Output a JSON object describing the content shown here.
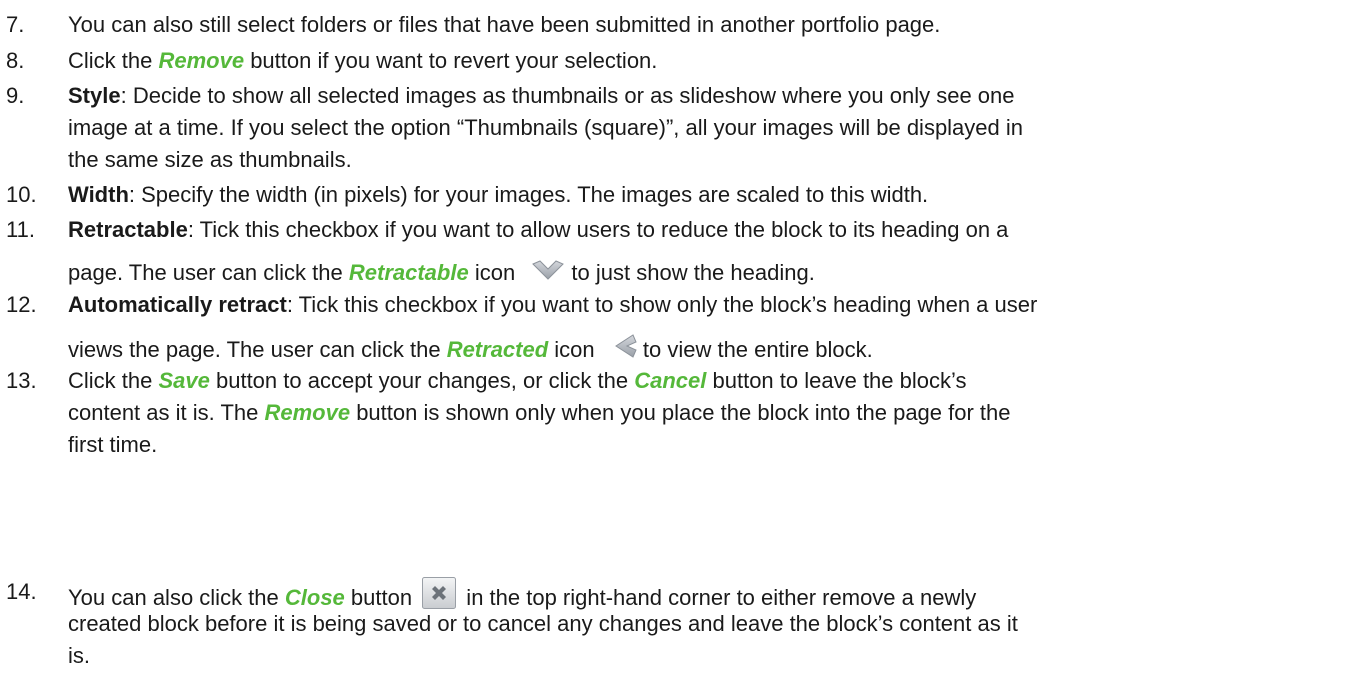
{
  "colors": {
    "term": "#55b83a",
    "text": "#1a1a1a"
  },
  "icons": {
    "retractable": "chevron-down-icon",
    "retracted": "chevron-left-icon",
    "close": "close-icon"
  },
  "items": {
    "i7": {
      "num": "7.",
      "text": "You can also still select folders or files that have been submitted in another portfolio page."
    },
    "i8": {
      "num": "8.",
      "pre": "Click the ",
      "term": "Remove",
      "post": " button if you want to revert your selection."
    },
    "i9": {
      "num": "9.",
      "label": "Style",
      "l1": ": Decide to show all selected images as thumbnails or as slideshow where you only see one",
      "l2": "image at a time. If you select the option “Thumbnails (square)”, all your images will be displayed in",
      "l3": "the same size as thumbnails."
    },
    "i10": {
      "num": "10.",
      "label": "Width",
      "l1": ": Specify the width (in pixels) for your images. The images are scaled to this width."
    },
    "i11": {
      "num": "11.",
      "label": "Retractable",
      "l1": ": Tick this checkbox if you want to allow users to reduce the block to its heading on a",
      "l2_pre": "page. The user can click the ",
      "l2_term": "Retractable",
      "l2_mid": " icon ",
      "l2_post": " to just show the heading."
    },
    "i12": {
      "num": "12.",
      "label": "Automatically retract",
      "l1": ": Tick this checkbox if you want to show only the block’s heading when a user",
      "l2_pre": "views the page. The user can click the ",
      "l2_term": "Retracted",
      "l2_mid": " icon ",
      "l2_post": " to view the entire block."
    },
    "i13": {
      "num": "13.",
      "l1_pre": "Click the ",
      "l1_term1": "Save",
      "l1_mid": " button to accept your changes, or click the ",
      "l1_term2": "Cancel",
      "l1_post": " button to leave the block’s",
      "l2_pre": "content as it is. The ",
      "l2_term": "Remove",
      "l2_post": " button is shown only when you place the block into the page for the",
      "l3": "first time."
    },
    "i14": {
      "num": "14.",
      "l1_pre": "You can also click the ",
      "l1_term": "Close",
      "l1_mid": " button ",
      "l1_post": " in the top right-hand corner to either remove a newly",
      "l2": "created block before it is being saved or to cancel any changes and leave the block’s content as it",
      "l3": "is."
    }
  }
}
